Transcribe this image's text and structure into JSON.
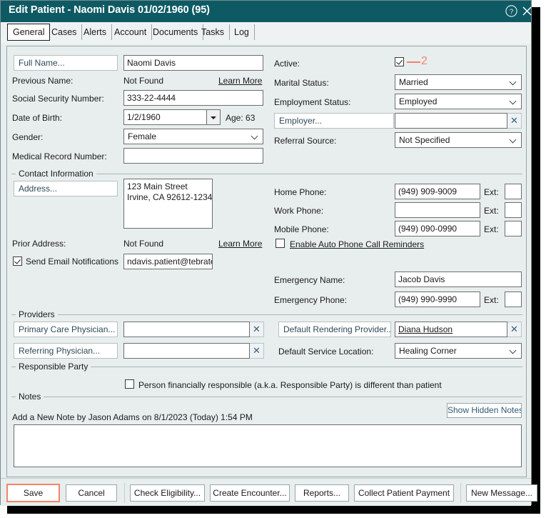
{
  "window": {
    "title": "Edit Patient - Naomi Davis 01/02/1960 (95)",
    "help_icon": "help-circle-icon",
    "close_icon": "close-icon",
    "accent_teal": "#0e5a64",
    "accent_orange": "#f2846a"
  },
  "tabs": [
    {
      "label": "General",
      "active": true
    },
    {
      "label": "Cases",
      "active": false
    },
    {
      "label": "Alerts",
      "active": false
    },
    {
      "label": "Account",
      "active": false
    },
    {
      "label": "Documents",
      "active": false
    },
    {
      "label": "Tasks",
      "active": false
    },
    {
      "label": "Log",
      "active": false
    }
  ],
  "demographics": {
    "full_name_button": "Full Name...",
    "full_name_value": "Naomi Davis",
    "previous_name_label": "Previous Name:",
    "previous_name_value": "Not Found",
    "previous_name_link": "Learn More",
    "ssn_label": "Social Security Number:",
    "ssn_value": "333-22-4444",
    "dob_label": "Date of Birth:",
    "dob_value": "1/2/1960",
    "age_text": "Age: 63",
    "gender_label": "Gender:",
    "gender_value": "Female",
    "mrn_label": "Medical Record Number:",
    "mrn_value": ""
  },
  "status": {
    "active_label": "Active:",
    "active_checked": true,
    "marital_label": "Marital Status:",
    "marital_value": "Married",
    "employment_label": "Employment Status:",
    "employment_value": "Employed",
    "employer_button": "Employer...",
    "employer_value": "",
    "referral_label": "Referral Source:",
    "referral_value": "Not Specified"
  },
  "annotation": {
    "number": "2"
  },
  "contact": {
    "group_title": "Contact Information",
    "address_button": "Address...",
    "address_value": "123 Main Street\nIrvine, CA 92612-1234",
    "prior_address_label": "Prior Address:",
    "prior_address_value": "Not Found",
    "prior_address_link": "Learn More",
    "send_email_label": "Send Email Notifications",
    "send_email_checked": true,
    "email_value": "ndavis.patient@tebrate",
    "home_phone_label": "Home Phone:",
    "home_phone_value": "(949) 909-9009",
    "home_ext_label": "Ext:",
    "home_ext_value": "",
    "work_phone_label": "Work Phone:",
    "work_phone_value": "",
    "work_ext_label": "Ext:",
    "work_ext_value": "",
    "mobile_phone_label": "Mobile Phone:",
    "mobile_phone_value": "(949) 090-0990",
    "mobile_ext_label": "Ext:",
    "mobile_ext_value": "",
    "auto_reminders_label": "Enable Auto Phone Call Reminders",
    "auto_reminders_checked": false,
    "emergency_name_label": "Emergency Name:",
    "emergency_name_value": "Jacob Davis",
    "emergency_phone_label": "Emergency Phone:",
    "emergency_phone_value": "(949) 990-9990",
    "emergency_ext_label": "Ext:",
    "emergency_ext_value": ""
  },
  "providers": {
    "group_title": "Providers",
    "pcp_button": "Primary Care Physician...",
    "pcp_value": "",
    "referring_button": "Referring Physician...",
    "referring_value": "",
    "rendering_button": "Default Rendering Provider...",
    "rendering_value": "Diana Hudson",
    "service_location_label": "Default Service Location:",
    "service_location_value": "Healing Corner"
  },
  "responsible_party": {
    "group_title": "Responsible Party",
    "checkbox_label": "Person financially responsible (a.k.a. Responsible Party) is different than patient",
    "checked": false
  },
  "notes": {
    "group_title": "Notes",
    "add_note_label": "Add a New Note by Jason Adams on 8/1/2023 (Today) 1:54 PM",
    "show_hidden_button": "Show Hidden Notes",
    "note_value": ""
  },
  "buttons": [
    {
      "label": "Save",
      "primary": true
    },
    {
      "label": "Cancel",
      "primary": false
    },
    {
      "label": "Check Eligibility...",
      "primary": false
    },
    {
      "label": "Create Encounter...",
      "primary": false
    },
    {
      "label": "Reports...",
      "primary": false
    },
    {
      "label": "Collect Patient Payment",
      "primary": false
    },
    {
      "label": "New Message...",
      "primary": false
    }
  ]
}
